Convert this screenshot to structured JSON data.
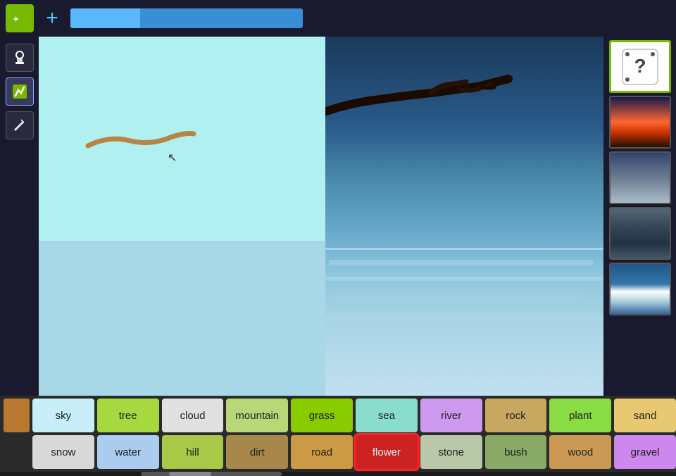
{
  "toolbar": {
    "logo_text": "✦",
    "add_label": "+",
    "progress_value": 30
  },
  "tools": [
    {
      "name": "stamp-tool",
      "icon": "⊙",
      "active": false
    },
    {
      "name": "brush-tool",
      "icon": "✏",
      "active": true
    },
    {
      "name": "pencil-tool",
      "icon": "✎",
      "active": false
    }
  ],
  "thumbnails": [
    {
      "name": "dice-thumb",
      "type": "dice",
      "icon": "?",
      "active": true
    },
    {
      "name": "sunset-thumb",
      "type": "sunset",
      "active": false
    },
    {
      "name": "clouds-thumb",
      "type": "clouds",
      "active": false
    },
    {
      "name": "rocky-thumb",
      "type": "rocky",
      "active": false
    },
    {
      "name": "waves-thumb",
      "type": "waves",
      "active": false
    }
  ],
  "labels_row1": [
    {
      "id": "sky",
      "label": "sky",
      "class": "btn-sky"
    },
    {
      "id": "tree",
      "label": "tree",
      "class": "btn-tree"
    },
    {
      "id": "cloud",
      "label": "cloud",
      "class": "btn-cloud"
    },
    {
      "id": "mountain",
      "label": "mountain",
      "class": "btn-mountain"
    },
    {
      "id": "grass",
      "label": "grass",
      "class": "btn-grass"
    },
    {
      "id": "sea",
      "label": "sea",
      "class": "btn-sea"
    },
    {
      "id": "river",
      "label": "river",
      "class": "btn-river"
    },
    {
      "id": "rock",
      "label": "rock",
      "class": "btn-rock"
    },
    {
      "id": "plant",
      "label": "plant",
      "class": "btn-plant"
    },
    {
      "id": "sand",
      "label": "sand",
      "class": "btn-sand"
    }
  ],
  "labels_row2": [
    {
      "id": "snow",
      "label": "snow",
      "class": "btn-snow"
    },
    {
      "id": "water",
      "label": "water",
      "class": "btn-water"
    },
    {
      "id": "hill",
      "label": "hill",
      "class": "btn-hill"
    },
    {
      "id": "dirt",
      "label": "dirt",
      "class": "btn-dirt"
    },
    {
      "id": "road",
      "label": "road",
      "class": "btn-road"
    },
    {
      "id": "flower",
      "label": "flower",
      "class": "btn-flower",
      "active": true
    },
    {
      "id": "stone",
      "label": "stone",
      "class": "btn-stone"
    },
    {
      "id": "bush",
      "label": "bush",
      "class": "btn-bush"
    },
    {
      "id": "wood",
      "label": "wood",
      "class": "btn-wood"
    },
    {
      "id": "gravel",
      "label": "gravel",
      "class": "btn-gravel"
    }
  ],
  "color_swatch": {
    "color": "#b87830"
  }
}
